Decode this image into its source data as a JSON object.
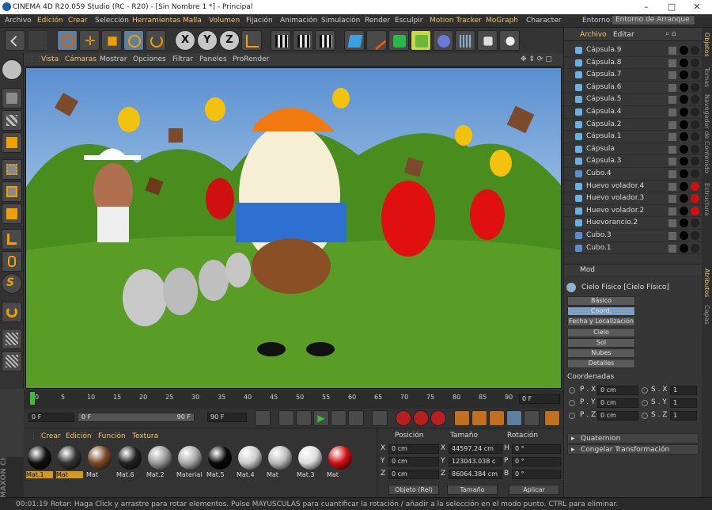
{
  "window": {
    "title": "CINEMA 4D R20.059 Studio (RC - R20) - [Sin Nombre 1 *] - Principal",
    "minimize": "–",
    "maximize": "□",
    "close": "✕"
  },
  "menu": [
    "Archivo",
    "Edición",
    "Crear",
    "Selección",
    "Herramientas",
    "Malla",
    "Volumen",
    "Fijación",
    "Animación",
    "Simulación",
    "Render",
    "Esculpir",
    "Motion Tracker",
    "MoGraph",
    "Character"
  ],
  "menu_highlight": [
    "Edición",
    "Crear",
    "Herramientas",
    "Malla",
    "Volumen",
    "Motion Tracker",
    "MoGraph"
  ],
  "layout": {
    "label": "Entorno:",
    "value": "Entorno de Arranque"
  },
  "viewport_menu": [
    "Vista",
    "Cámaras",
    "Mostrar",
    "Opciones",
    "Filtrar",
    "Paneles",
    "ProRender"
  ],
  "toolbar_axes": [
    "X",
    "Y",
    "Z"
  ],
  "timeline": {
    "ticks": [
      "0",
      "5",
      "10",
      "15",
      "20",
      "25",
      "30",
      "35",
      "40",
      "45",
      "50",
      "55",
      "60",
      "65",
      "70",
      "75",
      "80",
      "85",
      "90"
    ],
    "frame_display": "0 F"
  },
  "transport": {
    "start": "0 F",
    "range_start": "0 F",
    "range_end": "90 F",
    "end": "90 F"
  },
  "materials": {
    "menu": [
      "Crear",
      "Edición",
      "Función",
      "Textura"
    ],
    "items": [
      {
        "label": "Mat.1",
        "color": "#111"
      },
      {
        "label": "Mat",
        "color": "#333"
      },
      {
        "label": "Mat",
        "color": "#7a4a28"
      },
      {
        "label": "Mat.6",
        "color": "#222"
      },
      {
        "label": "Mat.2",
        "color": "#999"
      },
      {
        "label": "Material",
        "color": "#aaa"
      },
      {
        "label": "Mat.5",
        "color": "#0a0a0a"
      },
      {
        "label": "Mat.4",
        "color": "#ccc"
      },
      {
        "label": "Mat",
        "color": "#bbb"
      },
      {
        "label": "Mat.3",
        "color": "#ddd"
      },
      {
        "label": "Mat",
        "color": "#d01010"
      }
    ]
  },
  "coords": {
    "headers": [
      "Posición",
      "Tamaño",
      "Rotación"
    ],
    "rows": [
      {
        "axis": "X",
        "pos": "0 cm",
        "size_axis": "X",
        "size": "44597.24 cm",
        "rot_axis": "H",
        "rot": "0 °"
      },
      {
        "axis": "Y",
        "pos": "0 cm",
        "size_axis": "Y",
        "size": "123043.038 c",
        "rot_axis": "P",
        "rot": "0 °"
      },
      {
        "axis": "Z",
        "pos": "0 cm",
        "size_axis": "Z",
        "size": "86064.384 cm",
        "rot_axis": "B",
        "rot": "0 °"
      }
    ],
    "mode": "Objeto (Rel)",
    "size_mode": "Tamaño",
    "apply": "Aplicar"
  },
  "objects": {
    "menu": [
      "Archivo",
      "Editar"
    ],
    "items": [
      "Cápsula.9",
      "Cápsula.8",
      "Cápsula.7",
      "Cápsula.6",
      "Cápsula.5",
      "Cápsula.4",
      "Cápsula.2",
      "Cápsula.1",
      "Cápsula",
      "Cápsula.3",
      "Cubo.4",
      "Huevo volador.4",
      "Huevo volador.3",
      "Huevo volador.2",
      "Huevorancio.2",
      "Cubo.3",
      "Cubo.1"
    ],
    "tabs": [
      "Objetos",
      "Tomas",
      "Navegador de Contenido",
      "Estructura"
    ]
  },
  "attributes": {
    "menu": "Mod",
    "object": "Cielo Físico [Cielo Físico]",
    "tabs": [
      "Básico",
      "Coord.",
      "Fecha y Localización",
      "Cielo",
      "Sol",
      "Nubes",
      "Detalles"
    ],
    "active_tab": "Coord.",
    "section": "Coordenadas",
    "rows": [
      {
        "l": "P . X",
        "v": "0 cm",
        "l2": "S . X",
        "v2": "1"
      },
      {
        "l": "P . Y",
        "v": "0 cm",
        "l2": "S . Y",
        "v2": "1"
      },
      {
        "l": "P . Z",
        "v": "0 cm",
        "l2": "S . Z",
        "v2": "1"
      }
    ],
    "collapsed": [
      "Quaternion",
      "Congelar Transformación"
    ],
    "side_tabs": [
      "Atributos",
      "Capas"
    ]
  },
  "status": {
    "time": "00:01:19",
    "message": "Rotar: Haga Click y arrastre para rotar elementos. Pulse MAYUSCULAS para cuantificar la rotación / añadir a la selección en el modo punto. CTRL para eliminar."
  },
  "brand": "MAXON CINEMA 4D"
}
